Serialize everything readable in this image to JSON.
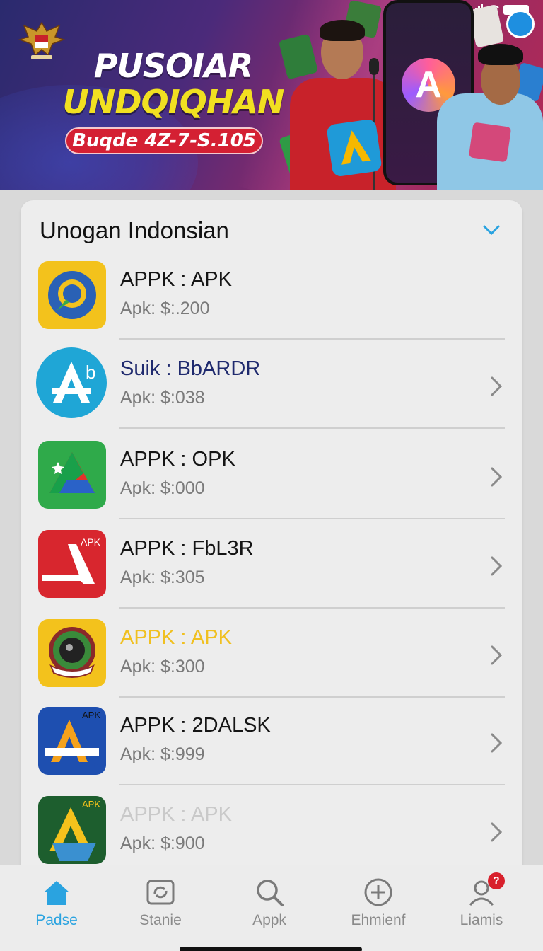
{
  "banner": {
    "line1": "PUSOIAR",
    "line2": "UNDQIQHAN",
    "pill": "Buqde 4Z-7-S.105",
    "colors": {
      "line2": "#f1e021",
      "pill": "#d42033"
    }
  },
  "section": {
    "title": "Unogan Indonsian",
    "chevron_icon": "chevron-down-icon"
  },
  "apps": [
    {
      "name": "APPK : APK",
      "sub": "Apk: $:.200",
      "icon": "yellow-sun-app-icon",
      "name_color": "#151515",
      "chevron": false
    },
    {
      "name": "Suik : BbARDR",
      "sub": "Apk: $:038",
      "icon": "appstore-a-icon",
      "name_color": "#1f2a6e",
      "chevron": true
    },
    {
      "name": "APPK : OPK",
      "sub": "Apk: $:000",
      "icon": "drive-triangle-icon",
      "name_color": "#151515",
      "chevron": true
    },
    {
      "name": "APPK : FbL3R",
      "sub": "Apk: $:305",
      "icon": "red-apk-icon",
      "name_color": "#151515",
      "chevron": true,
      "tag": "APK"
    },
    {
      "name": "APPK : APK",
      "sub": "Apk: $:300",
      "icon": "emblem-badge-icon",
      "name_color": "#f0c020",
      "chevron": true
    },
    {
      "name": "APPK : 2DALSK",
      "sub": "Apk: $:999",
      "icon": "blue-a-apk-icon",
      "name_color": "#151515",
      "chevron": true,
      "tag": "APK"
    },
    {
      "name": "APPK : APK",
      "sub": "Apk: $:900",
      "icon": "green-a-apk-icon",
      "name_color": "#c9c9c9",
      "chevron": true,
      "tag": "APK"
    }
  ],
  "tabbar": {
    "tabs": [
      {
        "label": "Padse",
        "icon": "home-icon",
        "active": true
      },
      {
        "label": "Stanie",
        "icon": "refresh-frame-icon",
        "active": false
      },
      {
        "label": "Appk",
        "icon": "search-icon",
        "active": false
      },
      {
        "label": "Ehmienf",
        "icon": "add-circle-icon",
        "active": false
      },
      {
        "label": "Liamis",
        "icon": "profile-icon",
        "active": false,
        "badge": "?"
      }
    ],
    "active_color": "#2aa3e0"
  }
}
